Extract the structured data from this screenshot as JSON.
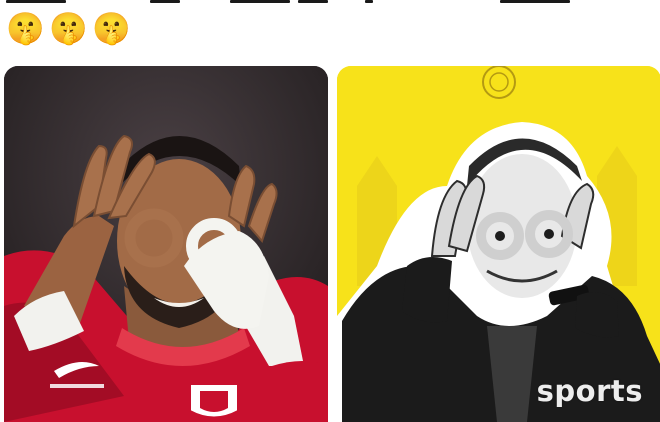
{
  "tweet": {
    "emojis": [
      "🤫",
      "🤫",
      "🤫"
    ],
    "media": [
      {
        "label": "Photo"
      },
      {
        "label": "Photo",
        "watermark": "sports"
      }
    ]
  },
  "colors": {
    "accent_yellow": "#f7e21a",
    "jersey_red": "#c8102e",
    "dark_background": "#2b2628"
  },
  "icons": [
    "shushing-face-emoji"
  ]
}
